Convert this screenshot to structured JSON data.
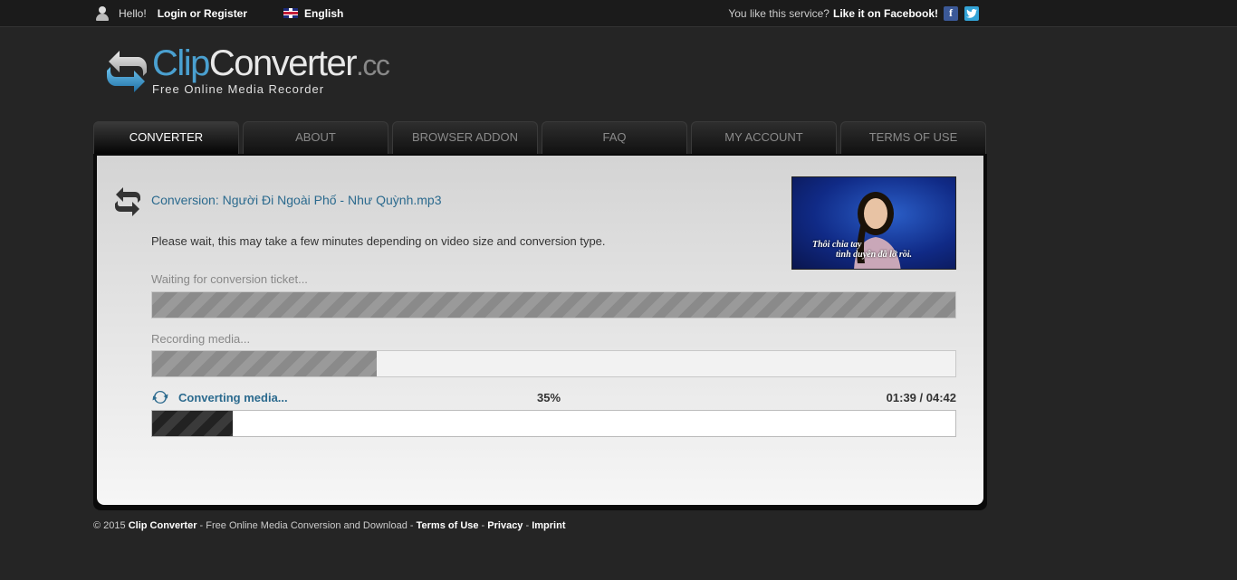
{
  "topbar": {
    "hello": "Hello!",
    "login_label": "Login or Register",
    "language": "English",
    "like_text": "You like this service?",
    "like_link": "Like it on Facebook!",
    "icons": [
      "user-icon",
      "uk-flag-icon",
      "facebook-icon",
      "twitter-icon"
    ]
  },
  "logo": {
    "name_part1": "Clip",
    "name_part2": "Converter",
    "name_tld": ".cc",
    "slogan": "Free Online Media Recorder"
  },
  "tabs": [
    {
      "label": "Converter",
      "active": true
    },
    {
      "label": "About"
    },
    {
      "label": "Browser Addon"
    },
    {
      "label": "FAQ"
    },
    {
      "label": "My Account"
    },
    {
      "label": "Terms of Use"
    }
  ],
  "conversion": {
    "title": "Conversion: Người Đi Ngoài Phố - Như Quỳnh.mp3",
    "wait_message": "Please wait, this may take a few minutes depending on video size and conversion type.",
    "thumbnail_caption_line1": "Thôi chia tay",
    "thumbnail_caption_line2": "tình duyên đã lỡ rồi.",
    "steps": [
      {
        "label": "Waiting for conversion ticket...",
        "progress": 1.0
      },
      {
        "label": "Recording media...",
        "progress": 0.28
      }
    ],
    "active_step": {
      "label": "Converting media...",
      "percent": "35%",
      "progress": 0.1,
      "time": "01:39 / 04:42"
    }
  },
  "footer": {
    "copyright": "© 2015",
    "brand": "Clip Converter",
    "desc": " - Free Online Media Conversion and Download - ",
    "terms": "Terms of Use",
    "sep1": " - ",
    "privacy": "Privacy",
    "sep2": " - ",
    "imprint": "Imprint"
  },
  "colors": {
    "background": "#252525",
    "accent": "#2b6a8e",
    "logo_blue": "#4aa0d0"
  }
}
